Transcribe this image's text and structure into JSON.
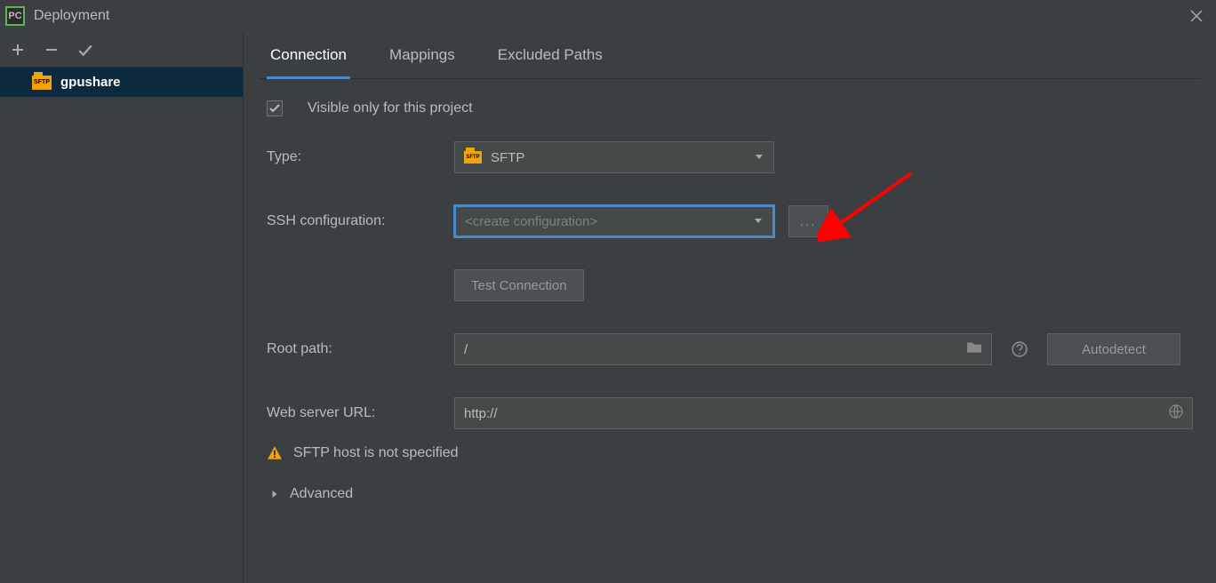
{
  "window": {
    "title": "Deployment",
    "icon_text": "PC"
  },
  "sidebar": {
    "server_name": "gpushare",
    "sftp_badge": "SFTP"
  },
  "tabs": {
    "connection": "Connection",
    "mappings": "Mappings",
    "excluded": "Excluded Paths"
  },
  "form": {
    "visible_label": "Visible only for this project",
    "type_label": "Type:",
    "type_value": "SFTP",
    "sftp_badge": "SFTP",
    "ssh_label": "SSH configuration:",
    "ssh_value": "<create configuration>",
    "ssh_more": "...",
    "test_conn": "Test Connection",
    "root_label": "Root path:",
    "root_value": "/",
    "autodetect": "Autodetect",
    "web_label": "Web server URL:",
    "web_value": "http://",
    "warning": "SFTP host is not specified",
    "advanced": "Advanced"
  }
}
